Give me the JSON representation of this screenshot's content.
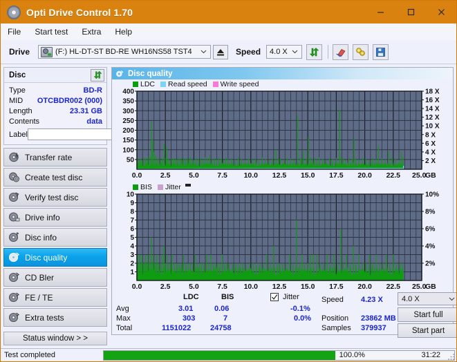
{
  "window": {
    "title": "Opti Drive Control 1.70",
    "icon": "disc-icon",
    "minimize": "minimize-icon",
    "maximize": "maximize-icon",
    "close": "close-icon",
    "accent": "#d9820f"
  },
  "menu": {
    "items": [
      "File",
      "Start test",
      "Extra",
      "Help"
    ]
  },
  "toolbar": {
    "drive_label": "Drive",
    "drive_value": "(F:)  HL-DT-ST BD-RE  WH16NS58 TST4",
    "eject_icon": "eject-icon",
    "speed_label": "Speed",
    "speed_value": "4.0 X",
    "refresh_icon": "refresh-icon",
    "erase_icon": "eraser-icon",
    "tools_icon": "tools-icon",
    "save_icon": "save-icon"
  },
  "disc": {
    "title": "Disc",
    "refresh_icon": "refresh-icon",
    "rows": [
      {
        "key": "Type",
        "value": "BD-R"
      },
      {
        "key": "MID",
        "value": "OTCBDR002 (000)"
      },
      {
        "key": "Length",
        "value": "23.31 GB"
      },
      {
        "key": "Contents",
        "value": "data"
      }
    ],
    "label_key": "Label",
    "label_value": "",
    "label_placeholder": "",
    "cd_icon": "cd-icon"
  },
  "nav": {
    "items": [
      {
        "label": "Transfer rate",
        "icon": "disc-transfer-icon",
        "active": false
      },
      {
        "label": "Create test disc",
        "icon": "disc-create-icon",
        "active": false
      },
      {
        "label": "Verify test disc",
        "icon": "disc-verify-icon",
        "active": false
      },
      {
        "label": "Drive info",
        "icon": "disc-drive-icon",
        "active": false
      },
      {
        "label": "Disc info",
        "icon": "disc-info-icon",
        "active": false
      },
      {
        "label": "Disc quality",
        "icon": "disc-quality-icon",
        "active": true
      },
      {
        "label": "CD Bler",
        "icon": "disc-bler-icon",
        "active": false
      },
      {
        "label": "FE / TE",
        "icon": "disc-fete-icon",
        "active": false
      },
      {
        "label": "Extra tests",
        "icon": "disc-extra-icon",
        "active": false
      }
    ],
    "status_window": "Status window > >"
  },
  "panel": {
    "title": "Disc quality",
    "icon": "disc-quality-icon"
  },
  "results": {
    "col_ldc": "LDC",
    "col_bis": "BIS",
    "jitter_label": "Jitter",
    "jitter_checked": true,
    "rows": [
      {
        "name": "Avg",
        "ldc": "3.01",
        "bis": "0.06",
        "jitter": "-0.1%"
      },
      {
        "name": "Max",
        "ldc": "303",
        "bis": "7",
        "jitter": "0.0%"
      },
      {
        "name": "Total",
        "ldc": "1151022",
        "bis": "24758",
        "jitter": ""
      }
    ],
    "speed_key": "Speed",
    "speed_value": "4.23 X",
    "position_key": "Position",
    "position_value": "23862 MB",
    "samples_key": "Samples",
    "samples_value": "379937",
    "speed_select": "4.0 X",
    "start_full": "Start full",
    "start_part": "Start part"
  },
  "statusbar": {
    "message": "Test completed",
    "progress_percent": "100.0%",
    "progress_value": 100,
    "elapsed": "31:22",
    "bar_color": "#13a313"
  },
  "chart_data": [
    {
      "type": "line",
      "title": "LDC / Read speed",
      "xlabel": "GB",
      "ylabel": "LDC",
      "xlim": [
        0.0,
        25.0
      ],
      "ylim": [
        0,
        400
      ],
      "y2lim": [
        0,
        18
      ],
      "y2label": "X",
      "grid": true,
      "legend_position": "top-left",
      "legend": [
        {
          "name": "LDC",
          "color": "#0f9c10"
        },
        {
          "name": "Read speed",
          "color": "#7ed3f5"
        },
        {
          "name": "Write speed",
          "color": "#f77ad8"
        }
      ],
      "xticks": [
        "0.0",
        "2.5",
        "5.0",
        "7.5",
        "10.0",
        "12.5",
        "15.0",
        "17.5",
        "20.0",
        "22.5",
        "25.0"
      ],
      "yticks": [
        50,
        100,
        150,
        200,
        250,
        300,
        350,
        400
      ],
      "y2ticks": [
        "2 X",
        "4 X",
        "6 X",
        "8 X",
        "10 X",
        "12 X",
        "14 X",
        "16 X",
        "18 X"
      ],
      "series": [
        {
          "name": "LDC",
          "color": "#0f9c10",
          "kind": "spikes",
          "baseline": 22,
          "x": [
            0.05,
            0.18,
            0.3,
            0.45,
            0.6,
            0.75,
            0.9,
            1.05,
            1.2,
            1.3,
            1.38,
            1.5,
            1.65,
            1.8,
            1.95,
            2.1,
            2.25,
            2.4,
            2.55,
            2.62,
            2.75,
            2.9,
            3.05,
            3.2,
            3.35,
            3.5,
            3.65,
            3.8,
            3.95,
            4.1,
            4.25,
            4.4,
            4.55,
            4.7,
            4.85,
            5.0,
            5.2,
            5.4,
            5.6,
            5.8,
            6.0,
            6.2,
            6.4,
            6.6,
            6.8,
            7.0,
            7.2,
            7.4,
            7.6,
            7.8,
            8.0,
            8.3,
            8.6,
            8.9,
            9.2,
            9.5,
            9.8,
            10.1,
            10.4,
            10.7,
            11.0,
            11.3,
            11.6,
            11.9,
            12.2,
            12.45,
            12.6,
            12.9,
            13.2,
            13.5,
            13.8,
            14.1,
            14.35,
            14.45,
            14.6,
            14.9,
            15.05,
            15.2,
            15.4,
            15.6,
            15.8,
            16.0,
            16.3,
            16.6,
            16.9,
            17.2,
            17.5,
            17.8,
            17.95,
            18.1,
            18.3,
            18.6,
            18.9,
            19.05,
            19.2,
            19.5,
            19.8,
            20.1,
            20.4,
            20.7,
            21.0,
            21.2,
            21.5,
            21.8,
            22.1,
            22.4,
            22.7,
            23.0,
            23.2,
            23.35
          ],
          "y": [
            60,
            45,
            52,
            48,
            60,
            55,
            50,
            70,
            62,
            240,
            150,
            88,
            70,
            55,
            60,
            48,
            52,
            130,
            60,
            115,
            55,
            48,
            60,
            52,
            58,
            50,
            62,
            55,
            48,
            60,
            52,
            58,
            50,
            62,
            55,
            48,
            60,
            52,
            58,
            50,
            62,
            55,
            70,
            52,
            58,
            50,
            62,
            55,
            48,
            60,
            52,
            58,
            50,
            62,
            55,
            48,
            60,
            52,
            58,
            50,
            62,
            55,
            48,
            60,
            100,
            52,
            58,
            50,
            62,
            55,
            48,
            275,
            60,
            52,
            95,
            58,
            165,
            60,
            52,
            58,
            50,
            62,
            55,
            48,
            60,
            52,
            58,
            305,
            62,
            55,
            48,
            60,
            52,
            155,
            58,
            50,
            62,
            55,
            48,
            60,
            52,
            118,
            58,
            50,
            95,
            62,
            55,
            48,
            90,
            60
          ]
        },
        {
          "name": "Read speed",
          "color": "#7ed3f5",
          "kind": "line",
          "x": [
            0.0,
            1.5,
            2.6,
            3.6,
            4.6,
            5.6,
            6.6,
            7.6,
            8.6,
            9.6,
            10.6,
            11.6,
            12.6,
            13.6,
            14.6,
            15.6,
            16.6,
            17.6,
            18.6,
            19.6,
            20.6,
            21.6,
            22.6,
            23.4,
            23.4
          ],
          "y": [
            1.9,
            1.9,
            2.2,
            2.4,
            2.5,
            2.6,
            2.7,
            2.8,
            2.9,
            3.0,
            3.1,
            3.2,
            3.25,
            3.3,
            3.4,
            3.5,
            3.6,
            3.7,
            3.8,
            3.85,
            3.9,
            3.95,
            4.0,
            4.05,
            18.0
          ]
        },
        {
          "name": "Write speed",
          "color": "#f77ad8",
          "kind": "line",
          "x": [],
          "y": []
        }
      ]
    },
    {
      "type": "line",
      "title": "BIS / Jitter",
      "xlabel": "GB",
      "ylabel": "BIS",
      "xlim": [
        0.0,
        25.0
      ],
      "ylim": [
        0,
        10
      ],
      "y2lim": [
        0,
        10
      ],
      "y2label": "%",
      "grid": true,
      "legend_position": "top-left",
      "legend": [
        {
          "name": "BIS",
          "color": "#0f9c10"
        },
        {
          "name": "Jitter",
          "color": "#c8a2cd"
        }
      ],
      "xticks": [
        "0.0",
        "2.5",
        "5.0",
        "7.5",
        "10.0",
        "12.5",
        "15.0",
        "17.5",
        "20.0",
        "22.5",
        "25.0"
      ],
      "yticks": [
        1,
        2,
        3,
        4,
        5,
        6,
        7,
        8,
        9,
        10
      ],
      "y2ticks": [
        "2%",
        "4%",
        "6%",
        "8%",
        "10%"
      ],
      "series": [
        {
          "name": "BIS",
          "color": "#0f9c10",
          "kind": "spikes",
          "baseline": 1.0,
          "x": [
            0.05,
            0.15,
            0.25,
            0.35,
            0.45,
            0.55,
            0.65,
            0.75,
            0.85,
            0.95,
            1.05,
            1.15,
            1.25,
            1.35,
            1.45,
            1.55,
            1.65,
            1.75,
            1.9,
            2.05,
            2.2,
            2.35,
            2.5,
            2.65,
            2.8,
            2.95,
            3.1,
            3.3,
            3.5,
            3.7,
            3.9,
            4.1,
            4.3,
            4.5,
            4.7,
            4.9,
            5.1,
            5.3,
            5.5,
            5.7,
            5.9,
            6.1,
            6.3,
            6.5,
            6.7,
            6.9,
            7.1,
            7.3,
            7.5,
            7.7,
            7.9,
            8.1,
            8.4,
            8.7,
            9.0,
            9.3,
            9.6,
            9.9,
            10.2,
            10.5,
            10.8,
            11.1,
            11.4,
            11.7,
            12.0,
            12.3,
            12.5,
            12.8,
            13.1,
            13.4,
            13.7,
            14.0,
            14.3,
            14.5,
            14.7,
            15.0,
            15.2,
            15.5,
            15.8,
            16.1,
            16.4,
            16.7,
            17.0,
            17.3,
            17.6,
            17.9,
            18.1,
            18.4,
            18.7,
            19.0,
            19.2,
            19.5,
            19.8,
            20.1,
            20.4,
            20.7,
            21.0,
            21.3,
            21.6,
            21.9,
            22.2,
            22.5,
            22.8,
            23.1,
            23.3
          ],
          "y": [
            3,
            2,
            3,
            2,
            3,
            2,
            2,
            3,
            2,
            2,
            3,
            2,
            5,
            2,
            3,
            2,
            2,
            3,
            2,
            2,
            3,
            4,
            2,
            3,
            2,
            2,
            3,
            2,
            2,
            2,
            2,
            3,
            2,
            2,
            2,
            2,
            3,
            2,
            2,
            2,
            2,
            3,
            2,
            3,
            2,
            2,
            2,
            2,
            3,
            2,
            2,
            2,
            2,
            2,
            2,
            2,
            2,
            2,
            2,
            2,
            2,
            2,
            3,
            2,
            4,
            2,
            2,
            2,
            2,
            3,
            2,
            7,
            2,
            3,
            2,
            2,
            3,
            3,
            3,
            2,
            2,
            3,
            2,
            3,
            2,
            6,
            2,
            3,
            2,
            4,
            2,
            3,
            2,
            2,
            3,
            2,
            3,
            2,
            2,
            3,
            2,
            3,
            2,
            2,
            2
          ]
        },
        {
          "name": "Jitter",
          "color": "#c8a2cd",
          "kind": "line",
          "x": [],
          "y": []
        }
      ]
    }
  ]
}
